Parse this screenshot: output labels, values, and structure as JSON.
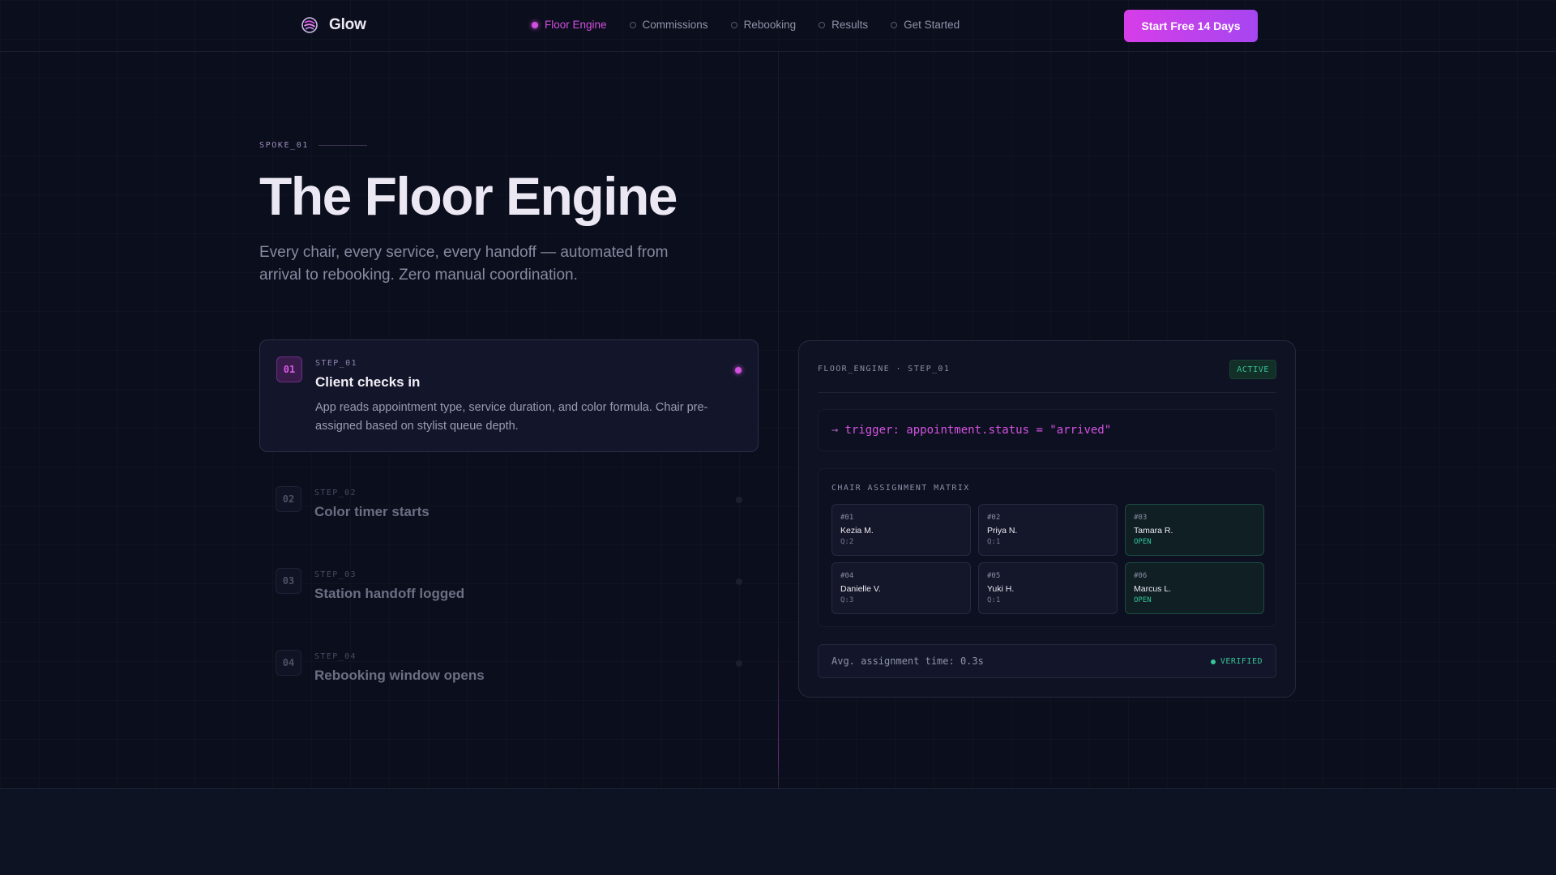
{
  "brand": {
    "name": "Glow"
  },
  "nav": {
    "items": [
      {
        "label": "Floor Engine",
        "active": true
      },
      {
        "label": "Commissions",
        "active": false
      },
      {
        "label": "Rebooking",
        "active": false
      },
      {
        "label": "Results",
        "active": false
      },
      {
        "label": "Get Started",
        "active": false
      }
    ],
    "cta_label": "Start Free 14 Days"
  },
  "hero": {
    "eyebrow": "SPOKE_01",
    "title": "The Floor Engine",
    "subtitle": "Every chair, every service, every handoff — automated from arrival to rebooking. Zero manual coordination."
  },
  "steps": [
    {
      "num": "01",
      "label": "STEP_01",
      "title": "Client checks in",
      "desc": "App reads appointment type, service duration, and color formula. Chair pre-assigned based on stylist queue depth.",
      "active": true
    },
    {
      "num": "02",
      "label": "STEP_02",
      "title": "Color timer starts",
      "active": false
    },
    {
      "num": "03",
      "label": "STEP_03",
      "title": "Station handoff logged",
      "active": false
    },
    {
      "num": "04",
      "label": "STEP_04",
      "title": "Rebooking window opens",
      "active": false
    }
  ],
  "panel": {
    "title": "FLOOR_ENGINE · STEP_01",
    "status": "ACTIVE",
    "trigger": "trigger: appointment.status = \"arrived\"",
    "trigger_arrow": "→",
    "matrix_title": "CHAIR ASSIGNMENT MATRIX",
    "chairs": [
      {
        "id": "#01",
        "name": "Kezia M.",
        "status": "Q:2",
        "open": false
      },
      {
        "id": "#02",
        "name": "Priya N.",
        "status": "Q:1",
        "open": false
      },
      {
        "id": "#03",
        "name": "Tamara R.",
        "status": "OPEN",
        "open": true
      },
      {
        "id": "#04",
        "name": "Danielle V.",
        "status": "Q:3",
        "open": false
      },
      {
        "id": "#05",
        "name": "Yuki H.",
        "status": "Q:1",
        "open": false
      },
      {
        "id": "#06",
        "name": "Marcus L.",
        "status": "OPEN",
        "open": true
      }
    ],
    "avg_text": "Avg. assignment time: 0.3s",
    "verified": "VERIFIED"
  },
  "colors": {
    "accent": "#d34fe0",
    "success": "#37c497",
    "background": "#0b0e1c"
  },
  "icons": {
    "logo": "glow-swirl-icon",
    "nav_dot": "dot-icon",
    "verified_dot": "status-dot-icon"
  }
}
